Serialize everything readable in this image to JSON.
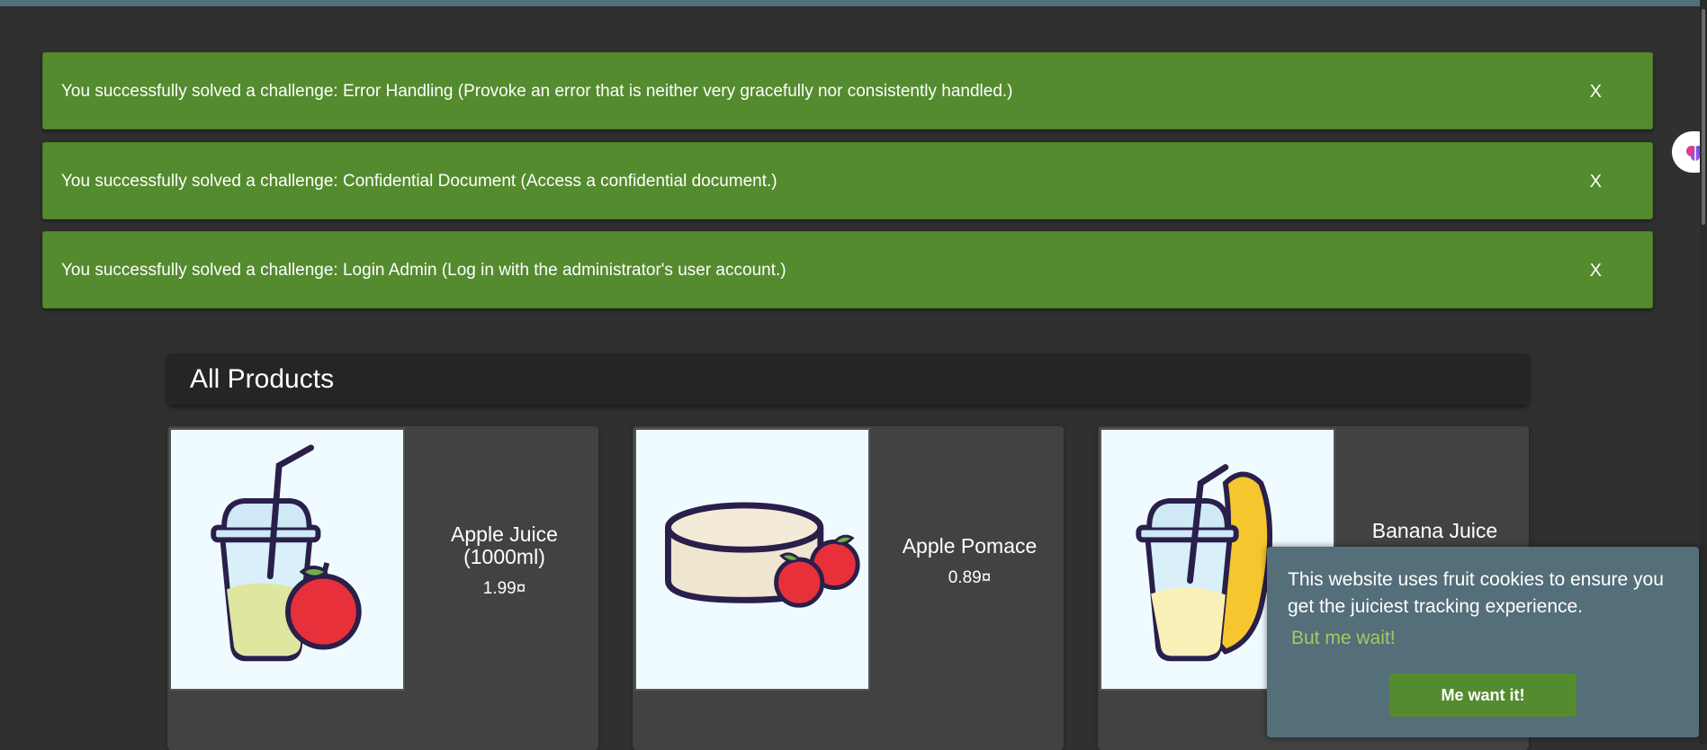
{
  "notifications": [
    {
      "message": "You successfully solved a challenge: Error Handling (Provoke an error that is neither very gracefully nor consistently handled.)",
      "close_label": "X"
    },
    {
      "message": "You successfully solved a challenge: Confidential Document (Access a confidential document.)",
      "close_label": "X"
    },
    {
      "message": "You successfully solved a challenge: Login Admin (Log in with the administrator's user account.)",
      "close_label": "X"
    }
  ],
  "main": {
    "title": "All Products",
    "products": [
      {
        "name": "Apple Juice (1000ml)",
        "price": "1.99¤",
        "icon": "apple-juice-image"
      },
      {
        "name": "Apple Pomace",
        "price": "0.89¤",
        "icon": "apple-pomace-image"
      },
      {
        "name": "Banana Juice",
        "price": "",
        "icon": "banana-juice-image"
      }
    ]
  },
  "cookie_banner": {
    "text": "This website uses fruit cookies to ensure you get the juiciest tracking experience.",
    "link_label": "But me wait!",
    "accept_label": "Me want it!"
  },
  "colors": {
    "background": "#303030",
    "toast_green": "#558b2f",
    "cookie_banner": "#546e7a",
    "card": "#424242"
  }
}
